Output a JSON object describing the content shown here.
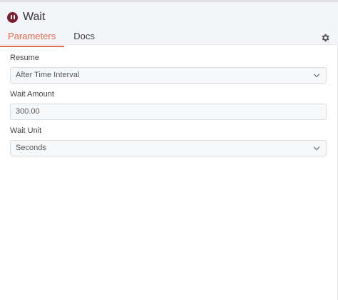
{
  "header": {
    "title": "Wait",
    "icon": "pause-icon",
    "accent_color": "#e06a4f",
    "icon_color": "#7a1f2f"
  },
  "tabs": [
    {
      "label": "Parameters",
      "active": true
    },
    {
      "label": "Docs",
      "active": false
    }
  ],
  "settings_icon": "gear-icon",
  "fields": {
    "resume": {
      "label": "Resume",
      "value": "After Time Interval"
    },
    "wait_amount": {
      "label": "Wait Amount",
      "value": "300.00"
    },
    "wait_unit": {
      "label": "Wait Unit",
      "value": "Seconds"
    }
  }
}
